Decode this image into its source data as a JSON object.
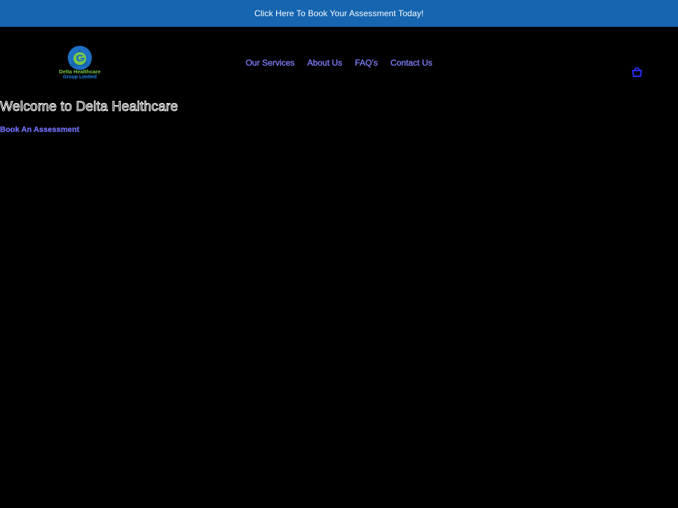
{
  "announcement": {
    "text": "Click Here To Book Your Assessment Today!",
    "background": "#1565b0"
  },
  "header": {
    "logo": {
      "line1": "Delta Healthcare",
      "line2": "Group Limited",
      "icon": "delta-healthcare-logo-icon"
    },
    "nav": [
      {
        "label": "Our Services"
      },
      {
        "label": "About Us"
      },
      {
        "label": "FAQ's"
      },
      {
        "label": "Contact Us"
      }
    ],
    "cart_icon": "shopping-bag-icon"
  },
  "hero": {
    "title": "Welcome to Delta Healthcare",
    "cta": "Book An Assessment"
  },
  "colors": {
    "page_background": "#000000",
    "link": "#6a6aff",
    "logo_green": "#7ac943",
    "logo_blue": "#1e88e5"
  }
}
